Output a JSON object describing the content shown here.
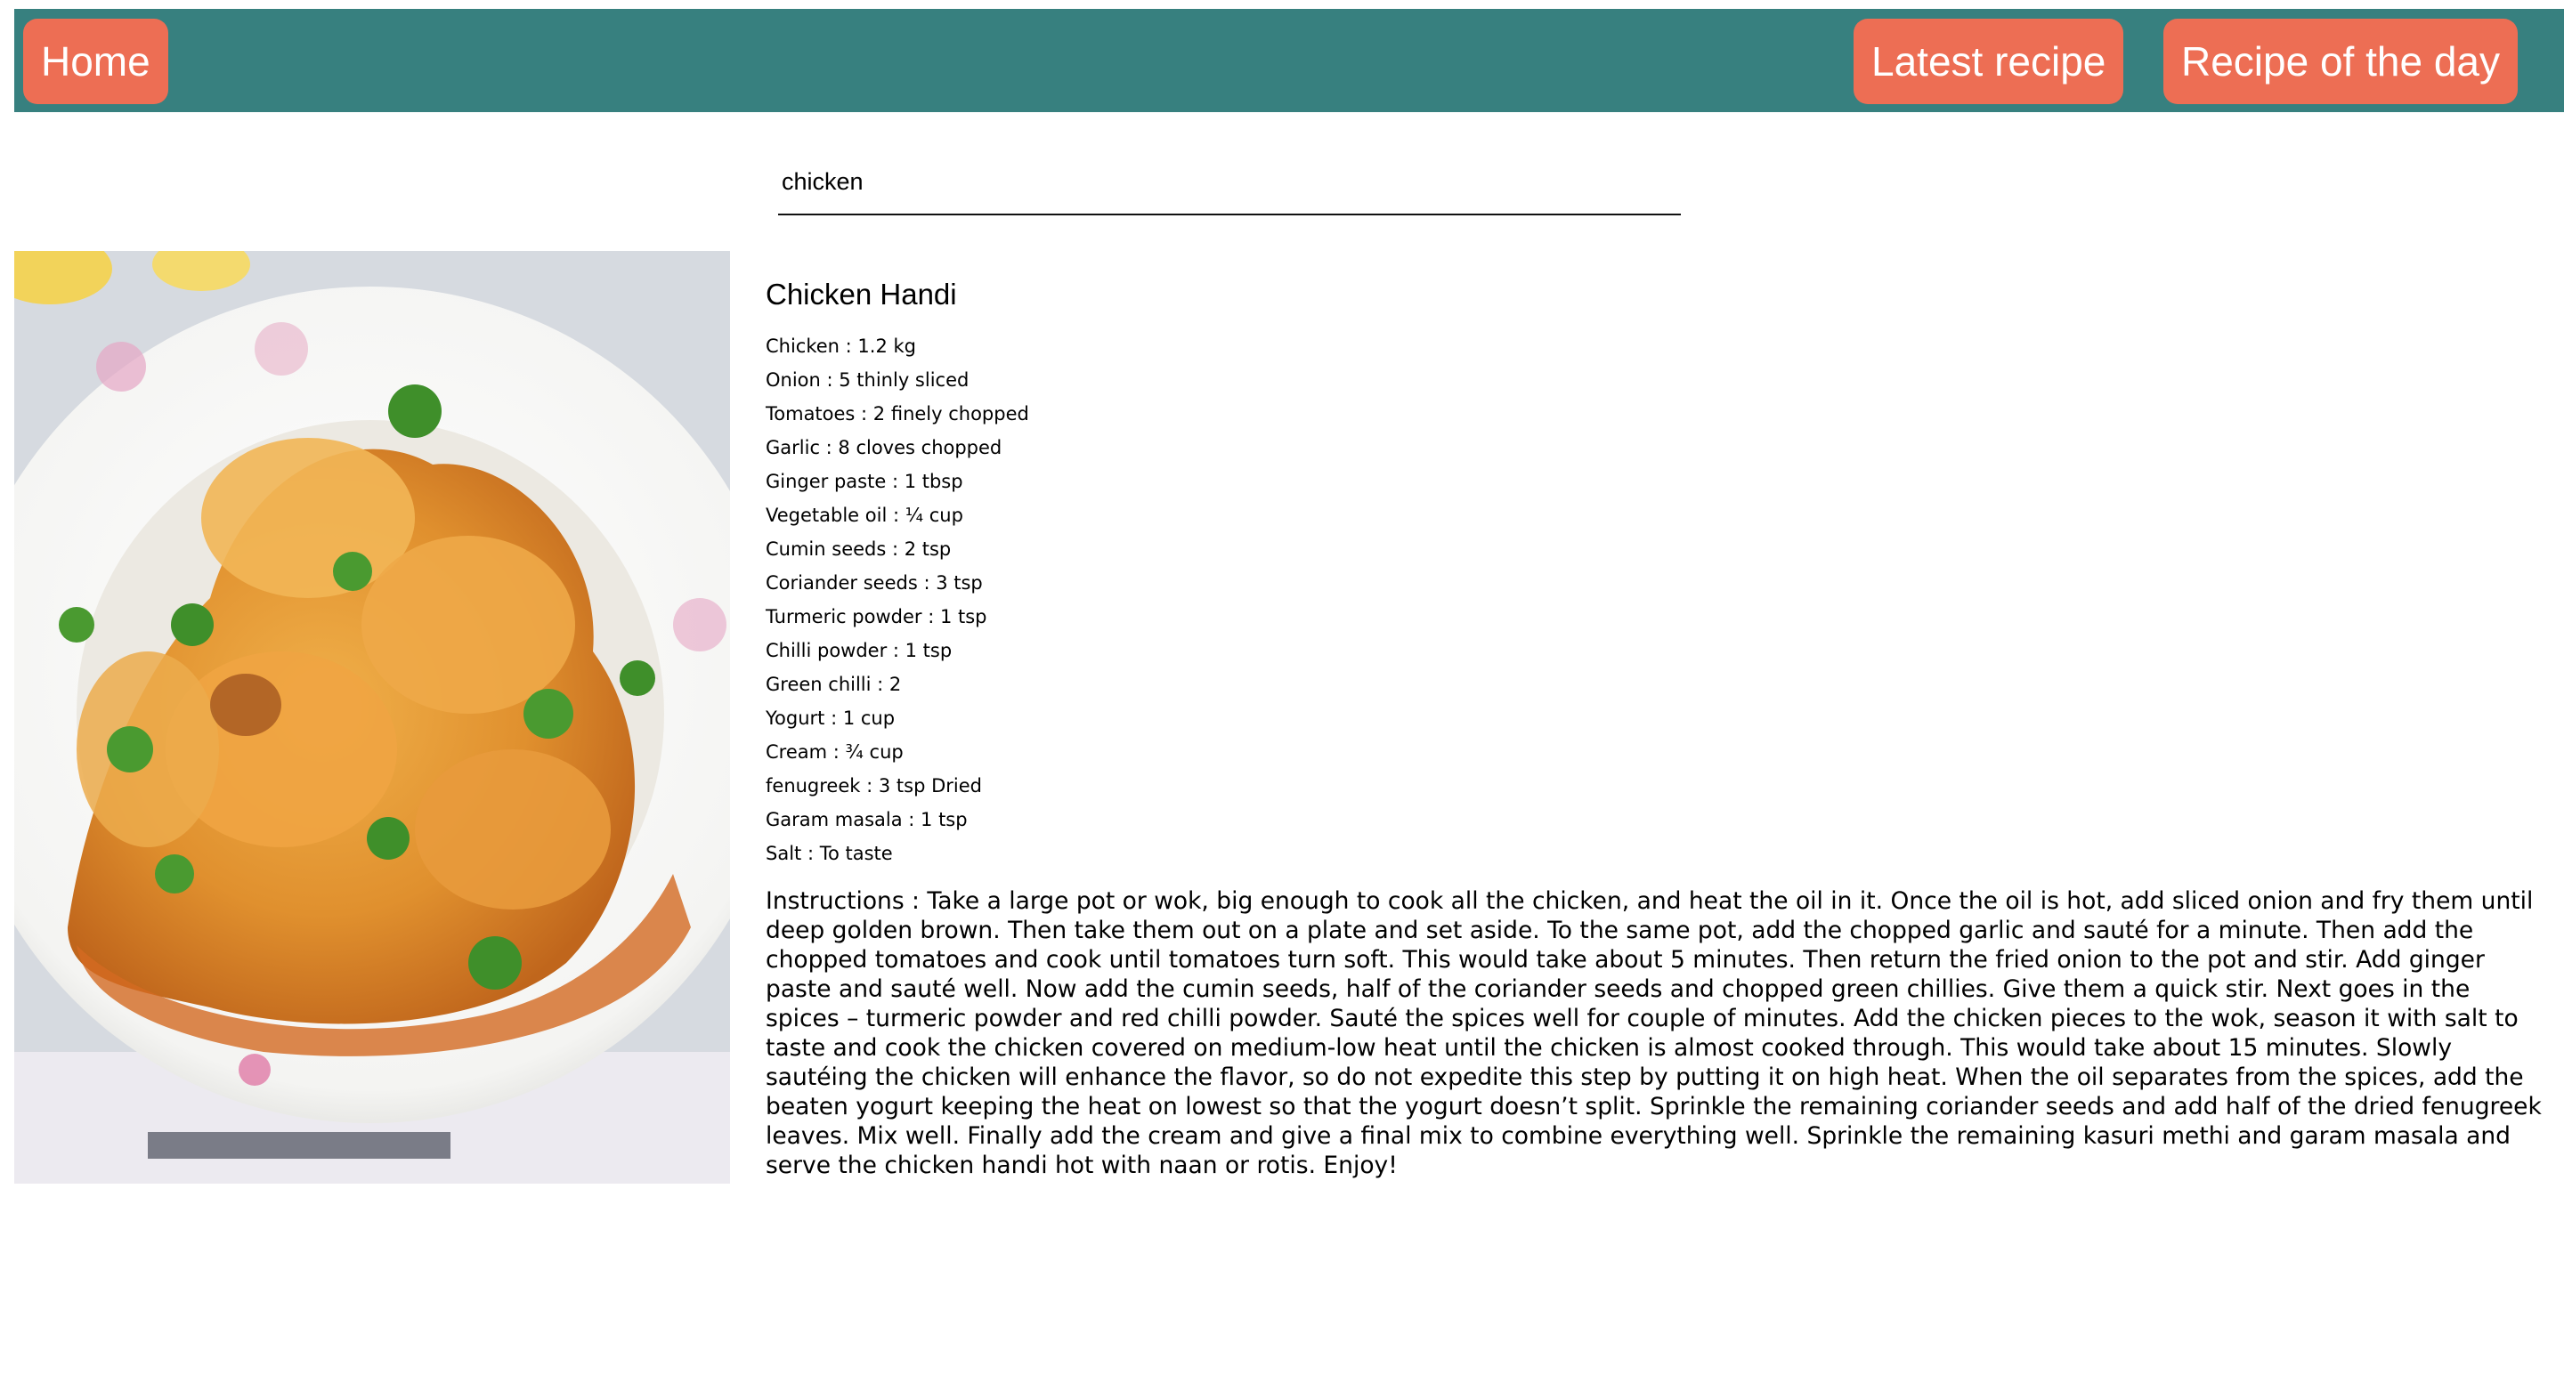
{
  "nav": {
    "home_label": "Home",
    "latest_label": "Latest recipe",
    "day_label": "Recipe of the day"
  },
  "search": {
    "value": "chicken"
  },
  "recipe": {
    "title": "Chicken Handi",
    "ingredients": [
      "Chicken : 1.2 kg",
      "Onion : 5 thinly sliced",
      "Tomatoes : 2 finely chopped",
      "Garlic : 8 cloves chopped",
      "Ginger paste : 1 tbsp",
      "Vegetable oil : ¼ cup",
      "Cumin seeds : 2 tsp",
      "Coriander seeds : 3 tsp",
      "Turmeric powder : 1 tsp",
      "Chilli powder : 1 tsp",
      "Green chilli : 2",
      "Yogurt : 1 cup",
      "Cream : ¾ cup",
      "fenugreek : 3 tsp Dried",
      "Garam masala : 1 tsp",
      "Salt : To taste"
    ],
    "instructions": "Instructions : Take a large pot or wok, big enough to cook all the chicken, and heat the oil in it. Once the oil is hot, add sliced onion and fry them until deep golden brown. Then take them out on a plate and set aside. To the same pot, add the chopped garlic and sauté for a minute. Then add the chopped tomatoes and cook until tomatoes turn soft. This would take about 5 minutes. Then return the fried onion to the pot and stir. Add ginger paste and sauté well. Now add the cumin seeds, half of the coriander seeds and chopped green chillies. Give them a quick stir. Next goes in the spices – turmeric powder and red chilli powder. Sauté the spices well for couple of minutes. Add the chicken pieces to the wok, season it with salt to taste and cook the chicken covered on medium-low heat until the chicken is almost cooked through. This would take about 15 minutes. Slowly sautéing the chicken will enhance the flavor, so do not expedite this step by putting it on high heat. When the oil separates from the spices, add the beaten yogurt keeping the heat on lowest so that the yogurt doesn’t split. Sprinkle the remaining coriander seeds and add half of the dried fenugreek leaves. Mix well. Finally add the cream and give a final mix to combine everything well. Sprinkle the remaining kasuri methi and garam masala and serve the chicken handi hot with naan or rotis. Enjoy!"
  },
  "colors": {
    "navbar": "#37807f",
    "button": "#ed6e54",
    "button_text": "#ffffff"
  }
}
